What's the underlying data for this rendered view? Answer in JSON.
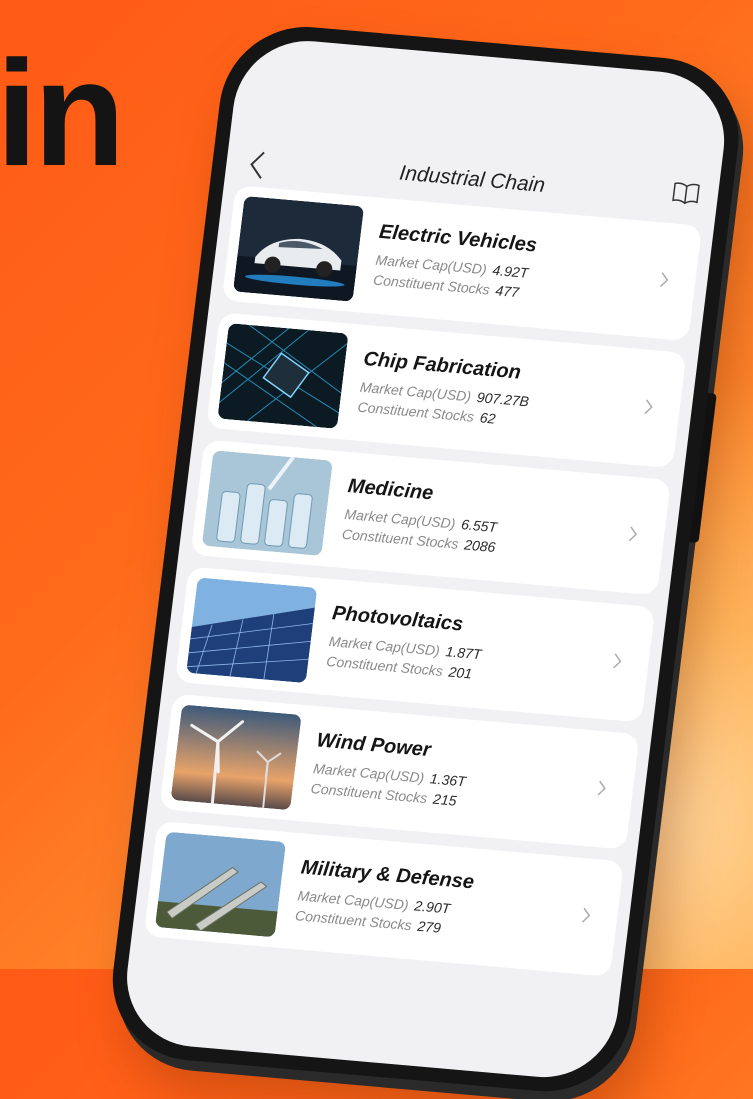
{
  "headline": "in",
  "nav": {
    "title": "Industrial Chain",
    "back_icon": "back-chevron-icon",
    "book_icon": "book-icon"
  },
  "labels": {
    "market_cap": "Market Cap(USD)",
    "stocks": "Constituent Stocks"
  },
  "items": [
    {
      "title": "Electric Vehicles",
      "market_cap": "4.92T",
      "stocks": "477"
    },
    {
      "title": "Chip Fabrication",
      "market_cap": "907.27B",
      "stocks": "62"
    },
    {
      "title": "Medicine",
      "market_cap": "6.55T",
      "stocks": "2086"
    },
    {
      "title": "Photovoltaics",
      "market_cap": "1.87T",
      "stocks": "201"
    },
    {
      "title": "Wind Power",
      "market_cap": "1.36T",
      "stocks": "215"
    },
    {
      "title": "Military & Defense",
      "market_cap": "2.90T",
      "stocks": "279"
    }
  ],
  "colors": {
    "background": "#ff6a1a",
    "phone_frame": "#151515",
    "screen": "#f1f1f3"
  }
}
